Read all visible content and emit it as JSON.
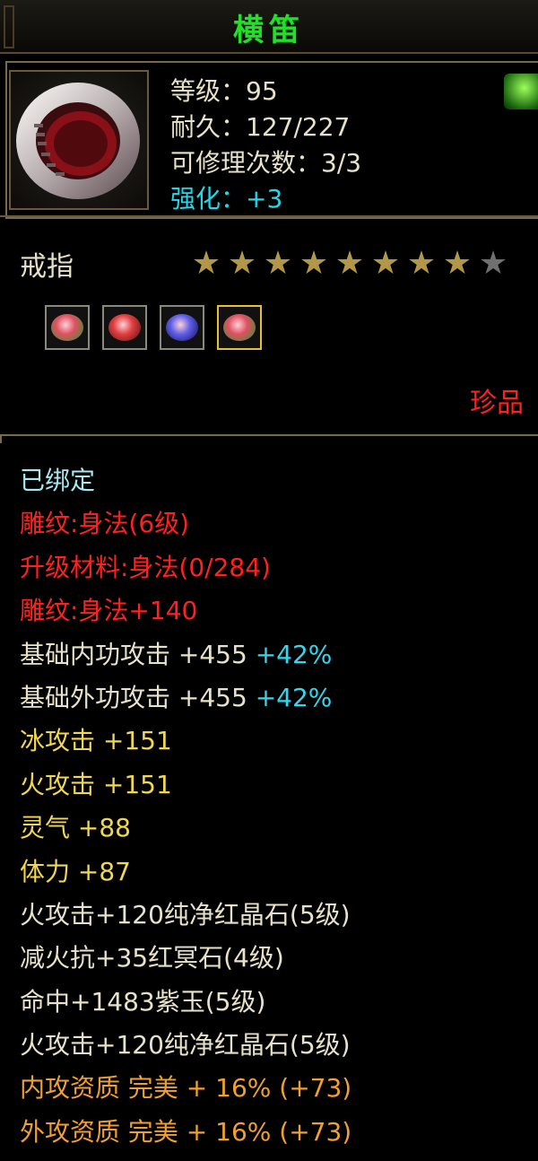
{
  "title": "横笛",
  "stats": {
    "level": "等级：95",
    "durability": "耐久：127/227",
    "repair": "可修理次数：3/3",
    "enhance": "强化：+3"
  },
  "item_type": "戒指",
  "stars": {
    "filled": 8,
    "total": 9
  },
  "gems": [
    {
      "icon": "green-red-gem-icon",
      "color": "#e05060",
      "rim": "#4a8a3a"
    },
    {
      "icon": "red-crystal-icon",
      "color": "#e04040",
      "rim": "#7a1a1a"
    },
    {
      "icon": "blue-crystal-icon",
      "color": "#6060e8",
      "rim": "#20207a"
    },
    {
      "icon": "green-red-gem-icon",
      "color": "#e05060",
      "rim": "#4a8a3a"
    }
  ],
  "rarity": "珍品",
  "attributes": [
    {
      "text": "已绑定",
      "color": "cyan"
    },
    {
      "text": "雕纹:身法(6级)",
      "color": "red"
    },
    {
      "text": "升级材料:身法(0/284)",
      "color": "red"
    },
    {
      "text": "雕纹:身法+140",
      "color": "red"
    },
    {
      "text": "基础内功攻击  +455 ",
      "pct": "+42%",
      "color": "white"
    },
    {
      "text": "基础外功攻击  +455 ",
      "pct": "+42%",
      "color": "white"
    },
    {
      "text": "冰攻击  +151",
      "color": "yellow"
    },
    {
      "text": "火攻击  +151",
      "color": "yellow"
    },
    {
      "text": "灵气  +88",
      "color": "yellow"
    },
    {
      "text": "体力  +87",
      "color": "yellow"
    },
    {
      "text": "火攻击+120纯净红晶石(5级)",
      "color": "white"
    },
    {
      "text": "减火抗+35红冥石(4级)",
      "color": "white"
    },
    {
      "text": "命中+1483紫玉(5级)",
      "color": "white"
    },
    {
      "text": "火攻击+120纯净红晶石(5级)",
      "color": "white"
    },
    {
      "text": "内攻资质  完美  + 16% (+73)",
      "color": "orange"
    },
    {
      "text": "外攻资质  完美  + 16% (+73)",
      "color": "orange"
    }
  ],
  "colors": {
    "title": "#22e02a",
    "cyan": "#a8e8f0",
    "red": "#ff2020",
    "white": "#e8e2c8",
    "yellow": "#f0d850",
    "orange": "#f0a030",
    "percent": "#30d8f0"
  }
}
